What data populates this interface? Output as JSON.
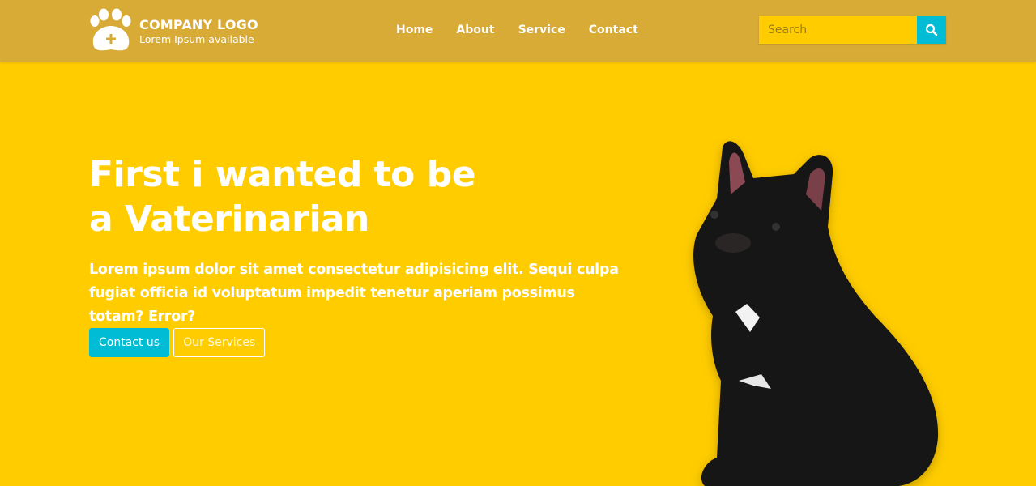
{
  "header": {
    "logo_title": "COMPANY LOGO",
    "logo_subtitle": "Lorem Ipsum available",
    "nav": [
      {
        "label": "Home"
      },
      {
        "label": "About"
      },
      {
        "label": "Service"
      },
      {
        "label": "Contact"
      }
    ],
    "search_placeholder": "Search",
    "search_icon": "search-icon"
  },
  "hero": {
    "title": "First i wanted to be a Vaterinarian",
    "lead": "Lorem ipsum dolor sit amet consectetur adipisicing elit. Sequi culpa fugiat officia id voluptatum impedit tenetur aperiam possimus totam? Error?",
    "primary_button": "Contact us",
    "secondary_button": "Our Services"
  },
  "colors": {
    "header": "#d8ab36",
    "background": "#ffcc00",
    "accent": "#00bcd4"
  }
}
